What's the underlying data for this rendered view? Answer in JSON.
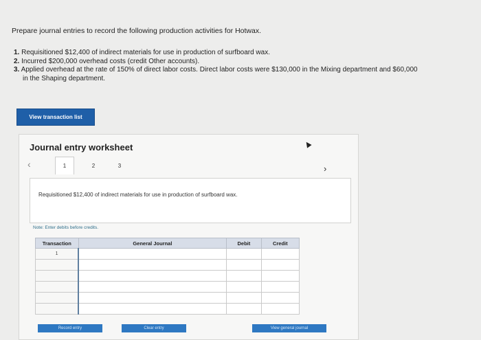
{
  "prompt": "Prepare journal entries to record the following production activities for Hotwax.",
  "steps": [
    {
      "num": "1.",
      "text": " Requisitioned $12,400 of indirect materials for use in production of surfboard wax."
    },
    {
      "num": "2.",
      "text": " Incurred $200,000 overhead costs (credit Other accounts)."
    },
    {
      "num": "3.",
      "text": " Applied overhead at the rate of 150% of direct labor costs. Direct labor costs were $130,000 in the Mixing department and $60,000",
      "continuation": "in the Shaping department."
    }
  ],
  "view_transaction_list": "View transaction list",
  "worksheet": {
    "title": "Journal entry worksheet",
    "tabs": [
      "1",
      "2",
      "3"
    ],
    "description": "Requisitioned $12,400 of indirect materials for use in production of surfboard wax.",
    "note": "Note: Enter debits before credits.",
    "table": {
      "headers": [
        "Transaction",
        "General Journal",
        "Debit",
        "Credit"
      ],
      "transaction_number": "1",
      "row_count": 6
    },
    "buttons": {
      "record": "Record entry",
      "clear": "Clear entry",
      "view_journal": "View general journal"
    }
  }
}
